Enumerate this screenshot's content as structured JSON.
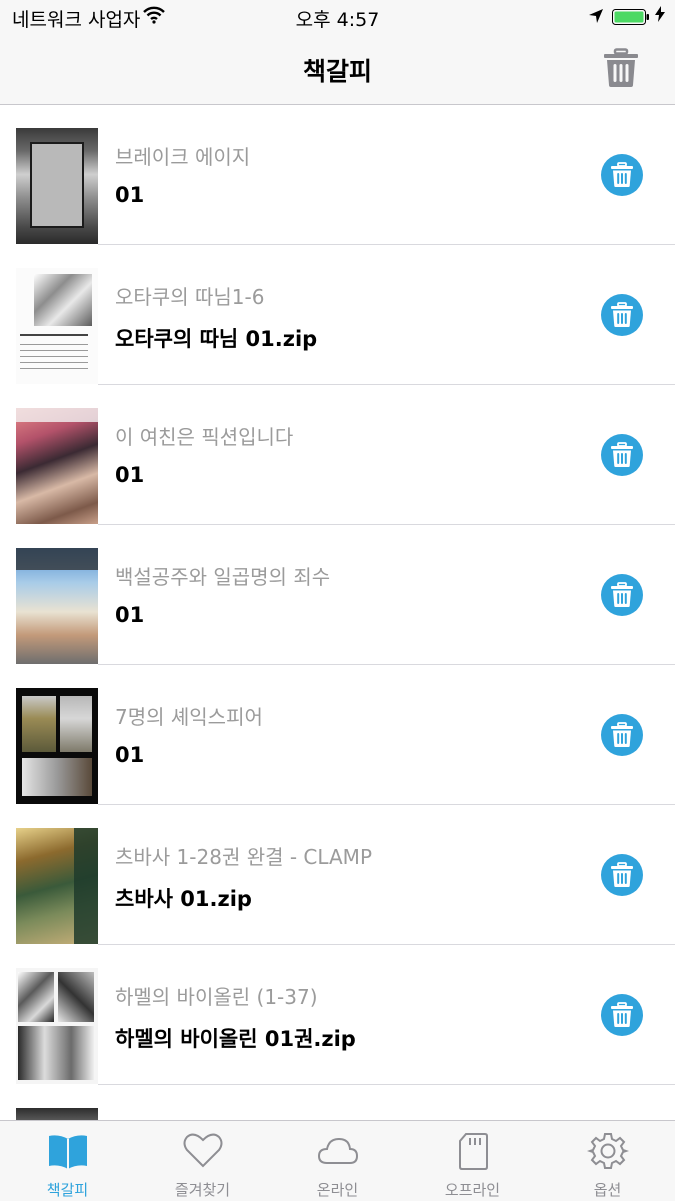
{
  "status_bar": {
    "carrier": "네트워크 사업자",
    "time": "오후 4:57",
    "icons": [
      "wifi-icon",
      "location-arrow-icon",
      "battery-icon",
      "charging-bolt-icon"
    ]
  },
  "nav": {
    "title": "책갈피",
    "right_icon": "trash-icon"
  },
  "bookmarks": [
    {
      "title": "브레이크 에이지",
      "subtitle": "01"
    },
    {
      "title": "오타쿠의 따님1-6",
      "subtitle": "오타쿠의 따님 01.zip"
    },
    {
      "title": "이 여친은 픽션입니다",
      "subtitle": "01"
    },
    {
      "title": "백설공주와 일곱명의 죄수",
      "subtitle": "01"
    },
    {
      "title": "7명의 셰익스피어",
      "subtitle": "01"
    },
    {
      "title": "츠바사 1-28권 완결 - CLAMP",
      "subtitle": "츠바사 01.zip"
    },
    {
      "title": "하멜의 바이올린 (1-37)",
      "subtitle": "하멜의 바이올린 01권.zip"
    }
  ],
  "tabs": [
    {
      "label": "책갈피",
      "icon": "book-icon",
      "active": true
    },
    {
      "label": "즐겨찾기",
      "icon": "heart-icon",
      "active": false
    },
    {
      "label": "온라인",
      "icon": "cloud-icon",
      "active": false
    },
    {
      "label": "오프라인",
      "icon": "sd-card-icon",
      "active": false
    },
    {
      "label": "옵션",
      "icon": "gear-icon",
      "active": false
    }
  ],
  "colors": {
    "accent": "#2fa3dc",
    "battery": "#4cd964",
    "title_gray": "#9b9b9b",
    "bar_bg": "#f7f7f7"
  }
}
